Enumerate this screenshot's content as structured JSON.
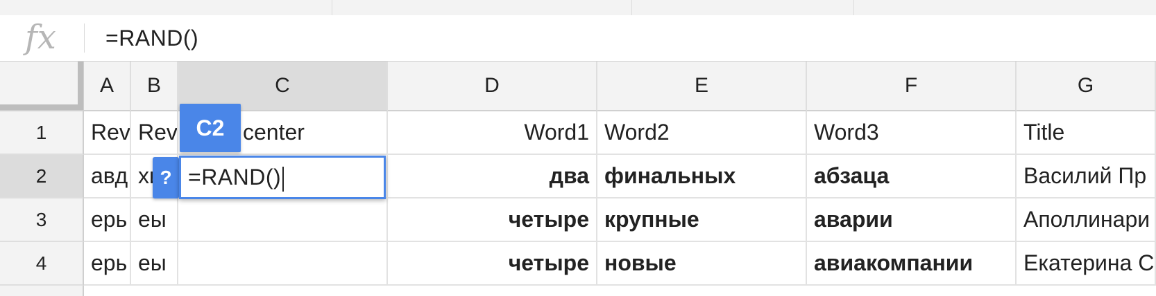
{
  "formula_bar": {
    "fx_label": "fx",
    "formula": "=RAND()"
  },
  "columns": [
    {
      "id": "A",
      "label": "A"
    },
    {
      "id": "B",
      "label": "B"
    },
    {
      "id": "C",
      "label": "C",
      "selected": true
    },
    {
      "id": "D",
      "label": "D"
    },
    {
      "id": "E",
      "label": "E"
    },
    {
      "id": "F",
      "label": "F"
    },
    {
      "id": "G",
      "label": "G"
    }
  ],
  "rows": [
    {
      "label": "1",
      "cells": {
        "A": "Rev",
        "B": "Reve",
        "C": "center",
        "D": "Word1",
        "E": "Word2",
        "F": "Word3",
        "G": "Title"
      }
    },
    {
      "label": "2",
      "selected": true,
      "cells": {
        "A": "авд",
        "B": "хи",
        "C": "",
        "D": "два",
        "E": "финальных",
        "F": "абзаца",
        "G": "Василий Пр"
      }
    },
    {
      "label": "3",
      "cells": {
        "A": "ерь",
        "B": "еы",
        "C": "",
        "D": "четыре",
        "E": "крупные",
        "F": "аварии",
        "G": "Аполлинари"
      }
    },
    {
      "label": "4",
      "cells": {
        "A": "ерь",
        "B": "еы",
        "C": "",
        "D": "четыре",
        "E": "новые",
        "F": "авиакомпании",
        "G": "Екатерина С"
      }
    }
  ],
  "active_cell": {
    "reference": "C2",
    "edit_value": "=RAND()",
    "help_label": "?"
  },
  "colors": {
    "accent": "#4a86e8",
    "header_bg": "#f3f3f3",
    "header_selected_bg": "#dcdcdc"
  }
}
